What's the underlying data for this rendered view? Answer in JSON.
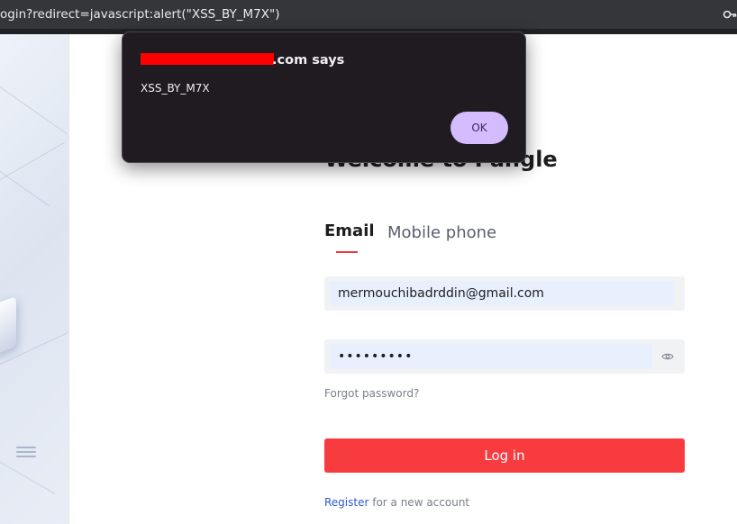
{
  "browser": {
    "url": "ogin?redirect=javascript:alert(\"XSS_BY_M7X\")"
  },
  "dialog": {
    "title_suffix": ".com says",
    "message": "XSS_BY_M7X",
    "ok_label": "OK"
  },
  "login": {
    "welcome": "Welcome to Pangle",
    "tabs": [
      {
        "label": "Email",
        "active": true
      },
      {
        "label": "Mobile phone",
        "active": false
      }
    ],
    "email_value": "mermouchibadrddin@gmail.com",
    "password_value": "•••••••••",
    "forgot_label": "Forgot password?",
    "login_label": "Log in",
    "register_label": "Register",
    "register_suffix": " for a new account"
  },
  "colors": {
    "accent": "#f73b3f",
    "tab_underline": "#e8383d",
    "link": "#2f5bcf",
    "dialog_bg": "#1f1b20",
    "ok_button": "#d4bcff"
  }
}
